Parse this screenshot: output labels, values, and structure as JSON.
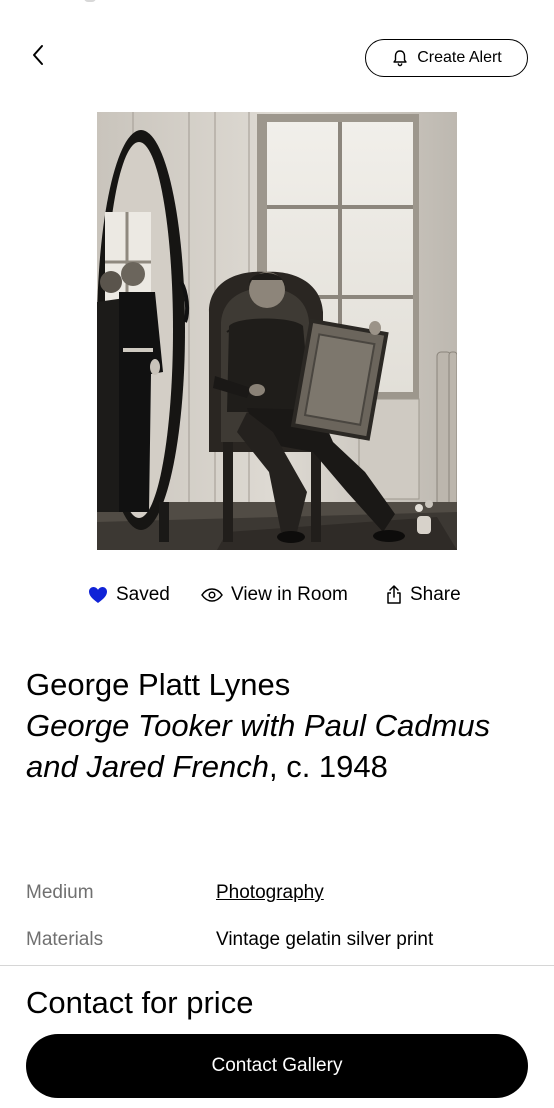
{
  "header": {
    "back_icon": "chevron-left-icon",
    "create_alert_label": "Create Alert",
    "create_alert_icon": "bell-icon"
  },
  "artwork_image": {
    "depicts": "black-and-white-photograph-of-three-men-one-seated-in-carved-chair-holding-a-frame-with-two-reflected-in-an-oval-mirror"
  },
  "actions": {
    "saved_label": "Saved",
    "saved_icon": "heart-icon",
    "saved_color": "#1023d7",
    "view_in_room_label": "View in Room",
    "view_in_room_icon": "eye-icon",
    "share_label": "Share",
    "share_icon": "share-icon"
  },
  "artwork": {
    "artist": "George Platt Lynes",
    "title": "George Tooker with Paul Cadmus and Jared French",
    "date": ", c. 1948"
  },
  "details": [
    {
      "label": "Medium",
      "value": "Photography"
    },
    {
      "label": "Materials",
      "value": "Vintage gelatin silver print"
    }
  ],
  "footer": {
    "price_text": "Contact for price",
    "contact_button_label": "Contact Gallery"
  },
  "colors": {
    "accent": "#000000",
    "saved_heart": "#1023d7",
    "muted_label": "#707070",
    "divider": "#d6d6d6"
  }
}
